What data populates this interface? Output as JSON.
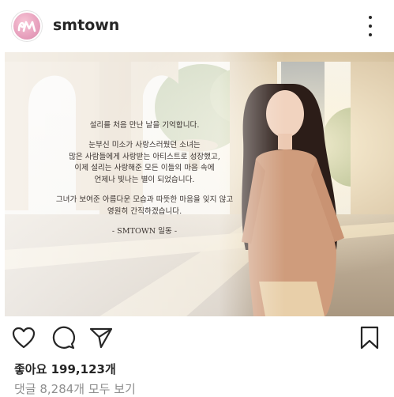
{
  "post": {
    "username": "smtown",
    "avatar_icon": "sm-logo-icon",
    "more_icon": "more-options-icon"
  },
  "photo": {
    "message_lines": [
      "설리를 처음 만난 날을 기억합니다.",
      "눈부신 미소가 사랑스러웠던 소녀는\n많은 사람들에게 사랑받는 아티스트로 성장했고,\n이제 설리는 사랑해준 모든 이들의 마음 속에\n언제나 빛나는 별이 되었습니다.",
      "그녀가 보여준 아름다운 모습과 따뜻한 마음을 잊지 않고\n영원히 간직하겠습니다."
    ],
    "signature": "- SMTOWN 일동 -"
  },
  "actions": {
    "like_icon": "heart-icon",
    "comment_icon": "comment-icon",
    "share_icon": "share-icon",
    "save_icon": "bookmark-icon"
  },
  "stats": {
    "likes_text": "좋아요 199,123개",
    "comments_text": "댓글 8,284개 모두 보기"
  },
  "colors": {
    "text": "#262626",
    "muted": "#8e8e8e",
    "avatar_pink": "#e7a0bd"
  }
}
